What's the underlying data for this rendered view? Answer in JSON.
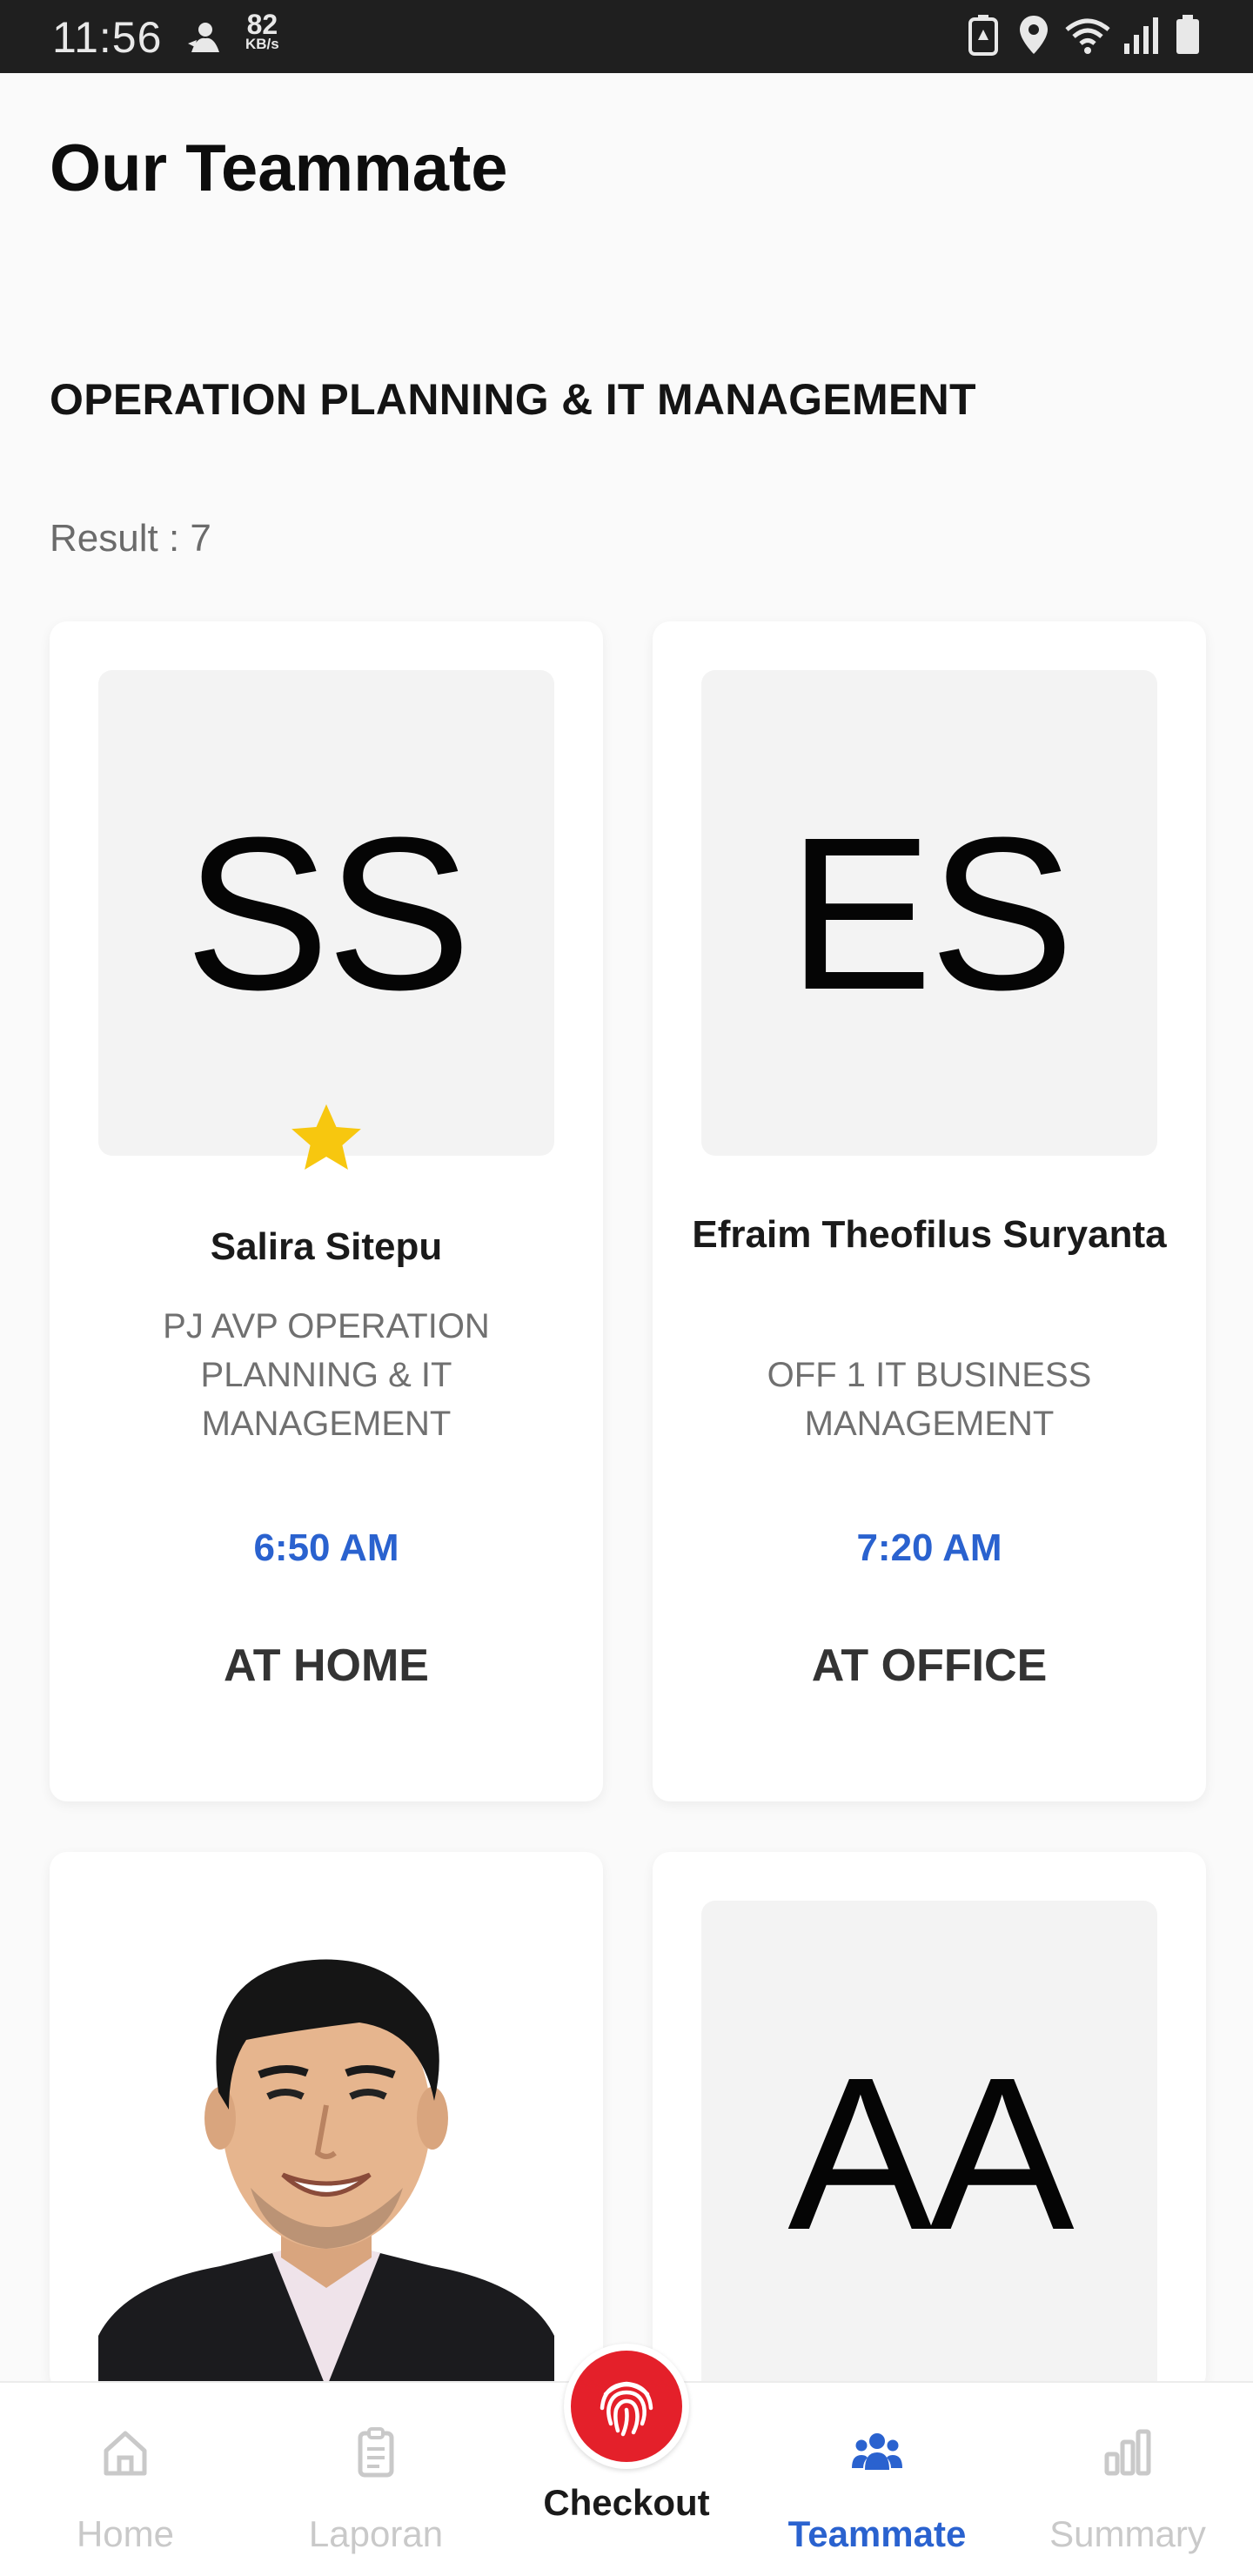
{
  "status_bar": {
    "time": "11:56",
    "net_speed_value": "82",
    "net_speed_unit": "KB/s",
    "icons": [
      "mascot-icon",
      "battery-saver-icon",
      "location-icon",
      "wifi-icon",
      "signal-icon",
      "battery-icon"
    ]
  },
  "header": {
    "title": "Our Teammate"
  },
  "section": {
    "title": "OPERATION PLANNING & IT MANAGEMENT",
    "result_label": "Result : 7"
  },
  "cards": [
    {
      "initials": "SS",
      "starred": true,
      "name": "Salira Sitepu",
      "role": "PJ AVP OPERATION PLANNING & IT MANAGEMENT",
      "time": "6:50 AM",
      "location": "AT HOME"
    },
    {
      "initials": "ES",
      "starred": false,
      "name": "Efraim Theofilus Suryanta",
      "role": "OFF 1 IT BUSINESS MANAGEMENT",
      "time": "7:20 AM",
      "location": "AT OFFICE"
    },
    {
      "initials": "",
      "photo": true
    },
    {
      "initials": "AA",
      "starred": false
    }
  ],
  "bottom_nav": {
    "items": [
      {
        "label": "Home",
        "icon": "home-icon"
      },
      {
        "label": "Laporan",
        "icon": "clipboard-icon"
      },
      {
        "label": "Checkout",
        "icon": "fingerprint-icon"
      },
      {
        "label": "Teammate",
        "icon": "team-icon",
        "active": true
      },
      {
        "label": "Summary",
        "icon": "bar-chart-icon"
      }
    ]
  },
  "colors": {
    "accent": "#2a62cf",
    "checkout": "#e4202a",
    "star": "#f7c70f",
    "statusbar": "#1f1f1f"
  }
}
